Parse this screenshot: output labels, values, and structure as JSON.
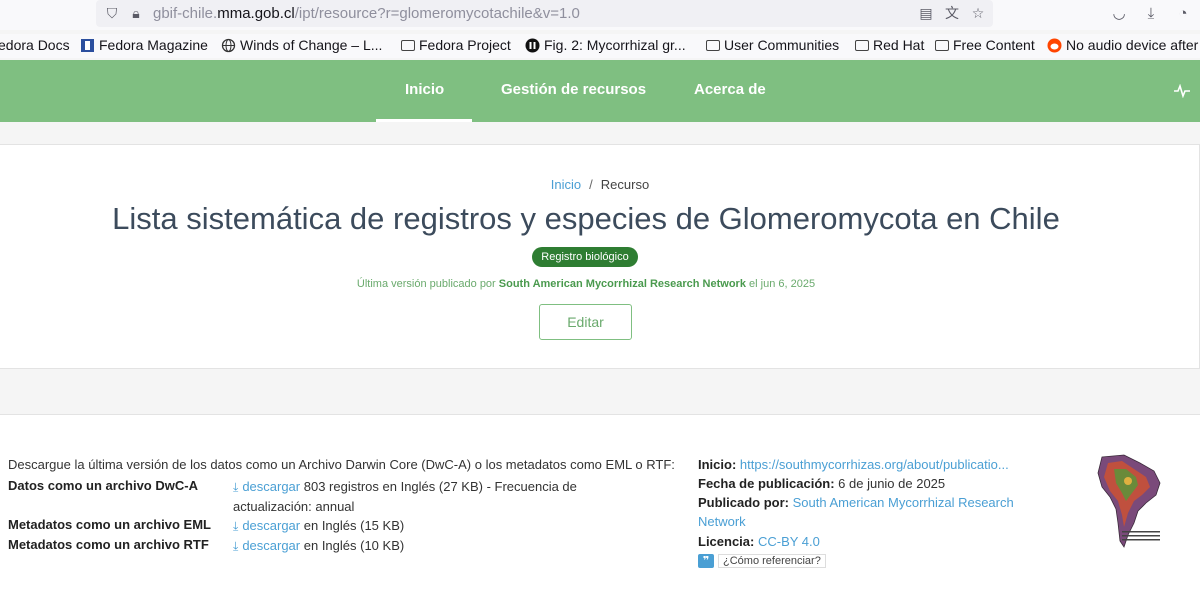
{
  "browser": {
    "url_prefix": "gbif-chile.",
    "url_domain": "mma.gob.cl",
    "url_path": "/ipt/resource?r=glomeromycotachile&v=1.0",
    "bookmarks": [
      {
        "label": "edora Docs",
        "icon": "fedora-icon"
      },
      {
        "label": "Fedora Magazine",
        "icon": "fedora-magazine-icon"
      },
      {
        "label": "Winds of Change – L...",
        "icon": "globe-icon"
      },
      {
        "label": "Fedora Project",
        "icon": "folder-icon"
      },
      {
        "label": "Fig. 2: Mycorrhizal gr...",
        "icon": "nature-icon"
      },
      {
        "label": "User Communities",
        "icon": "folder-icon"
      },
      {
        "label": "Red Hat",
        "icon": "folder-icon"
      },
      {
        "label": "Free Content",
        "icon": "folder-icon"
      },
      {
        "label": "No audio device after",
        "icon": "reddit-icon"
      }
    ]
  },
  "nav": {
    "items": [
      "Inicio",
      "Gestión de recursos",
      "Acerca de"
    ],
    "active": "Inicio"
  },
  "header": {
    "breadcrumb_home": "Inicio",
    "breadcrumb_sep": "/",
    "breadcrumb_current": "Recurso",
    "title": "Lista sistemática de registros y especies de Glomeromycota en Chile",
    "badge": "Registro biológico",
    "pub_prefix": "Última versión publicado por",
    "pub_org": "South American Mycorrhizal Research Network",
    "pub_suffix": "el jun 6, 2025",
    "edit_label": "Editar"
  },
  "downloads": {
    "intro": "Descargue la última versión de los datos como un Archivo Darwin Core (DwC-A) o los metadatos como EML o RTF:",
    "rows": [
      {
        "label": "Datos como un archivo DwC-A",
        "link": "descargar",
        "text1": "803 registros en Inglés (27 KB) - Frecuencia de",
        "text2": "actualización: annual"
      },
      {
        "label": "Metadatos como un archivo EML",
        "link": "descargar",
        "text1": "en Inglés (15 KB)"
      },
      {
        "label": "Metadatos como un archivo RTF",
        "link": "descargar",
        "text1": "en Inglés (10 KB)"
      }
    ]
  },
  "meta": {
    "inicio_label": "Inicio:",
    "inicio_link": "https://southmycorrhizas.org/about/publicatio...",
    "fecha_label": "Fecha de publicación:",
    "fecha_value": "6 de junio de 2025",
    "publicado_label": "Publicado por:",
    "publicado_line1": "South American Mycorrhizal Research",
    "publicado_line2": "Network",
    "licencia_label": "Licencia:",
    "licencia_value": "CC-BY 4.0",
    "cite_label": "¿Cómo referenciar?"
  },
  "colors": {
    "nav_bg": "#7fbf81",
    "badge_bg": "#2e7d32",
    "link": "#4a9fd4"
  }
}
